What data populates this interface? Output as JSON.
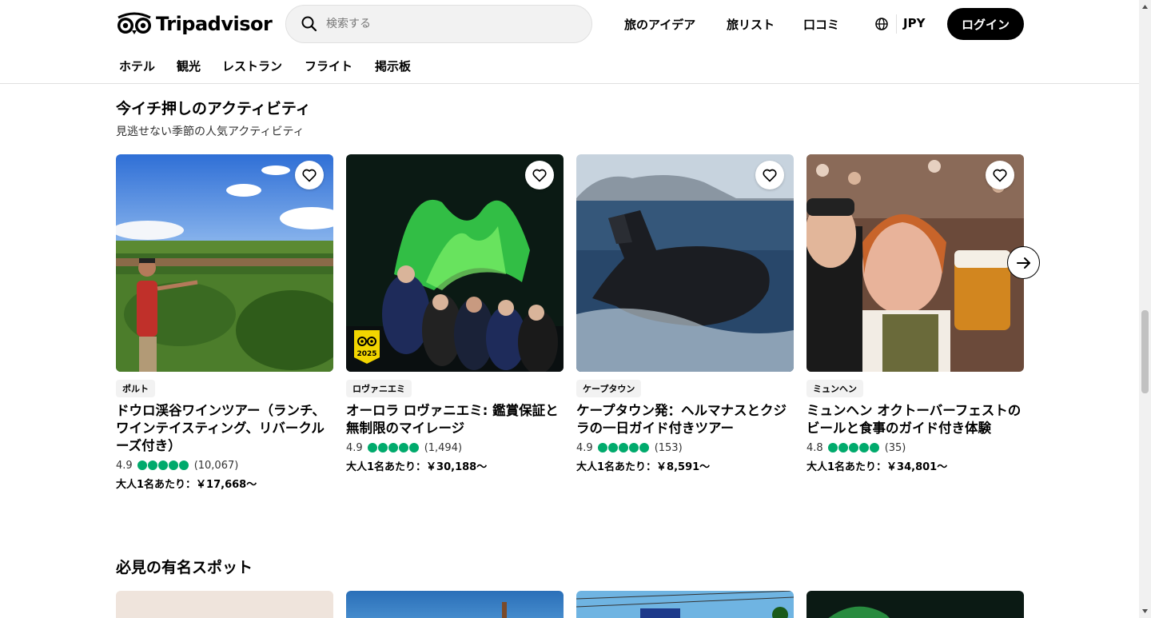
{
  "header": {
    "logo_text": "Tripadvisor",
    "search_placeholder": "検索する",
    "nav": [
      "旅のアイデア",
      "旅リスト",
      "口コミ"
    ],
    "currency": "JPY",
    "login": "ログイン"
  },
  "subnav": [
    "ホテル",
    "観光",
    "レストラン",
    "フライト",
    "掲示板"
  ],
  "activities": {
    "title": "今イチ押しのアクティビティ",
    "subtitle": "見逃せない季節の人気アクティビティ",
    "cards": [
      {
        "location": "ポルト",
        "title": "ドウロ渓谷ワインツアー（ランチ、ワインテイスティング、リバークルーズ付き）",
        "rating": "4.9",
        "reviews": "(10,067)",
        "stars": 5,
        "price": "大人1名あたり：￥17,668〜",
        "badge": ""
      },
      {
        "location": "ロヴァニエミ",
        "title": "オーロラ ロヴァニエミ: 鑑賞保証と無制限のマイレージ",
        "rating": "4.9",
        "reviews": "(1,494)",
        "stars": 5,
        "price": "大人1名あたり：￥30,188〜",
        "badge": "2025"
      },
      {
        "location": "ケープタウン",
        "title": "ケープタウン発：ヘルマナスとクジラの一日ガイド付きツアー",
        "rating": "4.9",
        "reviews": "(153)",
        "stars": 5,
        "price": "大人1名あたり：￥8,591〜",
        "badge": ""
      },
      {
        "location": "ミュンヘン",
        "title": "ミュンヘン オクトーバーフェストのビールと食事のガイド付き体験",
        "rating": "4.8",
        "reviews": "(35)",
        "stars": 5,
        "price": "大人1名あたり：￥34,801〜",
        "badge": ""
      }
    ]
  },
  "spots": {
    "title": "必見の有名スポット"
  },
  "colors": {
    "rating_green": "#00aa6c",
    "brand_black": "#000000"
  }
}
